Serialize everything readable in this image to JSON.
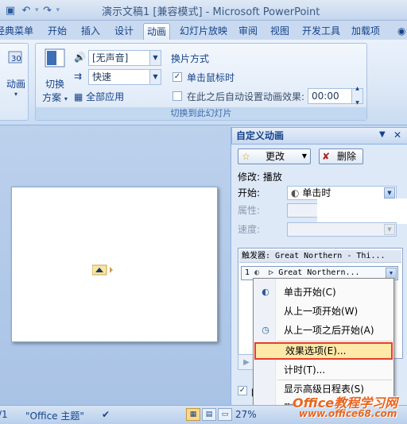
{
  "window": {
    "title": "演示文稿1 [兼容模式] - Microsoft PowerPoint"
  },
  "ribbon_tabs": [
    {
      "label": "经典菜单"
    },
    {
      "label": "开始"
    },
    {
      "label": "插入"
    },
    {
      "label": "设计"
    },
    {
      "label": "动画",
      "active": true
    },
    {
      "label": "幻灯片放映"
    },
    {
      "label": "审阅"
    },
    {
      "label": "视图"
    },
    {
      "label": "开发工具"
    },
    {
      "label": "加载项"
    }
  ],
  "ribbon": {
    "animation_button": "动画",
    "switch_scheme_button_line1": "切换",
    "switch_scheme_button_line2": "方案",
    "sound_value": "[无声音]",
    "speed_value": "快速",
    "apply_all": "全部应用",
    "transition_header": "换片方式",
    "on_click": "单击鼠标时",
    "on_click_checked": true,
    "auto_after": "在此之后自动设置动画效果:",
    "auto_after_checked": false,
    "auto_time": "00:00",
    "group_label": "切换到此幻灯片"
  },
  "task_pane": {
    "title": "自定义动画",
    "change_button": "更改",
    "delete_button": "删除",
    "modify_label": "修改: 播放",
    "start_label": "开始:",
    "start_value": "单击时",
    "property_label": "属性:",
    "speed_label": "速度:",
    "trigger_row": "触发器: Great Northern - Thi...",
    "item_number": "1",
    "item_text": "Great Northern...",
    "bottom_check_label": "自"
  },
  "context_menu": {
    "items": [
      {
        "label": "单击开始(C)",
        "icon": "mouse-click-icon"
      },
      {
        "label": "从上一项开始(W)",
        "icon": ""
      },
      {
        "label": "从上一项之后开始(A)",
        "icon": "clock-icon"
      },
      {
        "label": "效果选项(E)...",
        "icon": "",
        "highlighted": true
      },
      {
        "label": "计时(T)...",
        "icon": ""
      },
      {
        "label": "显示高级日程表(S)",
        "icon": ""
      },
      {
        "label": "删除",
        "icon": ""
      }
    ]
  },
  "statusbar": {
    "slide_indicator": "/1",
    "theme": "\"Office 主题\"",
    "zoom": "27%"
  },
  "watermark": {
    "line1": "Office教程学习网",
    "line2": "www.office68.com"
  }
}
